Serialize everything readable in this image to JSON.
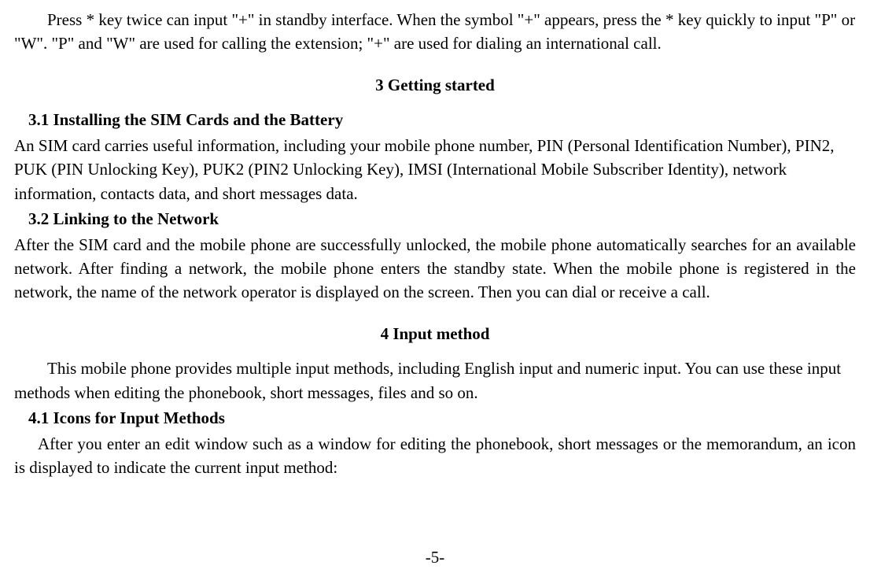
{
  "intro": {
    "p1": "Press * key twice can input \"+\" in standby interface. When the symbol \"+\" appears, press the * key quickly to input \"P\" or \"W\". \"P\" and \"W\" are used for calling the extension; \"+\" are used for dialing an international call."
  },
  "section3": {
    "title": "3      Getting started",
    "s31_title": "3.1     Installing the SIM Cards and the Battery",
    "s31_body": "An SIM card carries useful information, including your mobile phone number, PIN (Personal Identification Number), PIN2, PUK (PIN Unlocking Key), PUK2 (PIN2 Unlocking Key), IMSI (International Mobile Subscriber Identity), network information, contacts data, and short messages data.",
    "s32_title": "3.2     Linking to the Network",
    "s32_body": "After the SIM card and the mobile phone are successfully unlocked, the mobile phone automatically searches for an available network. After finding a network, the mobile phone enters the standby state. When the mobile phone is registered in the network, the name of the network operator is displayed on the screen. Then you can dial or receive a call."
  },
  "section4": {
    "title": "4      Input method",
    "intro": "This mobile phone provides multiple input methods, including English input and numeric input. You can use these input methods when editing the phonebook, short messages, files and so on.",
    "s41_title": "4.1     Icons for Input Methods",
    "s41_body": "After you enter an edit window such as a window for editing the phonebook, short messages or the memorandum, an icon is displayed to indicate the current input method:"
  },
  "page_number": "-5-"
}
